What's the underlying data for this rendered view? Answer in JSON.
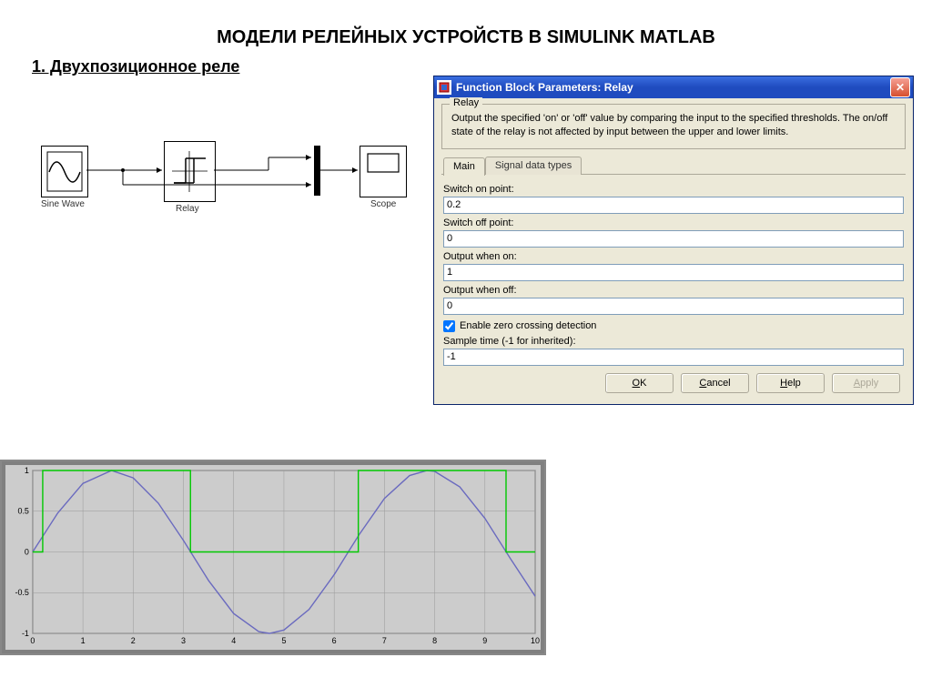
{
  "page": {
    "title": "МОДЕЛИ РЕЛЕЙНЫХ  УСТРОЙСТВ В SIMULINK MATLAB",
    "subtitle": "1. Двухпозиционное реле"
  },
  "diagram": {
    "blocks": {
      "sine": "Sine Wave",
      "relay": "Relay",
      "scope": "Scope"
    }
  },
  "dialog": {
    "title": "Function Block Parameters: Relay",
    "group_title": "Relay",
    "description": "Output the specified 'on' or 'off' value by comparing the input to the specified thresholds.  The on/off state of the relay is not affected by input between the upper and lower limits.",
    "tabs": {
      "main": "Main",
      "signal": "Signal data types"
    },
    "fields": {
      "switch_on_label": "Switch on point:",
      "switch_on_value": "0.2",
      "switch_off_label": "Switch off point:",
      "switch_off_value": "0",
      "output_on_label": "Output when on:",
      "output_on_value": "1",
      "output_off_label": "Output when off:",
      "output_off_value": "0",
      "zero_crossing_label": "Enable zero crossing detection",
      "zero_crossing_checked": true,
      "sample_time_label": "Sample time (-1 for inherited):",
      "sample_time_value": "-1"
    },
    "buttons": {
      "ok": "OK",
      "cancel": "Cancel",
      "help": "Help",
      "apply": "Apply"
    }
  },
  "chart_data": {
    "type": "line",
    "x": [
      0,
      1,
      2,
      3,
      4,
      5,
      6,
      7,
      8,
      9,
      10
    ],
    "xlabel": "",
    "ylabel": "",
    "xlim": [
      0,
      10
    ],
    "ylim": [
      -1,
      1
    ],
    "yticks": [
      -1,
      -0.5,
      0,
      0.5,
      1
    ],
    "series": [
      {
        "name": "sine",
        "color": "#6a6abf",
        "x": [
          0,
          0.5,
          1,
          1.57,
          2,
          2.5,
          3,
          3.5,
          4,
          4.5,
          4.71,
          5,
          5.5,
          6,
          6.28,
          6.5,
          7,
          7.5,
          7.85,
          8,
          8.5,
          9,
          9.5,
          10
        ],
        "values": [
          0,
          0.479,
          0.841,
          1.0,
          0.909,
          0.599,
          0.141,
          -0.351,
          -0.757,
          -0.978,
          -1.0,
          -0.959,
          -0.706,
          -0.279,
          0,
          0.215,
          0.657,
          0.938,
          1.0,
          0.989,
          0.798,
          0.412,
          -0.075,
          -0.544
        ]
      },
      {
        "name": "relay_output",
        "color": "#00c800",
        "kind": "step",
        "x": [
          0,
          0.2,
          0.2,
          3.14,
          3.14,
          6.48,
          6.48,
          9.42,
          9.42,
          10
        ],
        "values": [
          0,
          0,
          1,
          1,
          0,
          0,
          1,
          1,
          0,
          0
        ]
      }
    ]
  }
}
